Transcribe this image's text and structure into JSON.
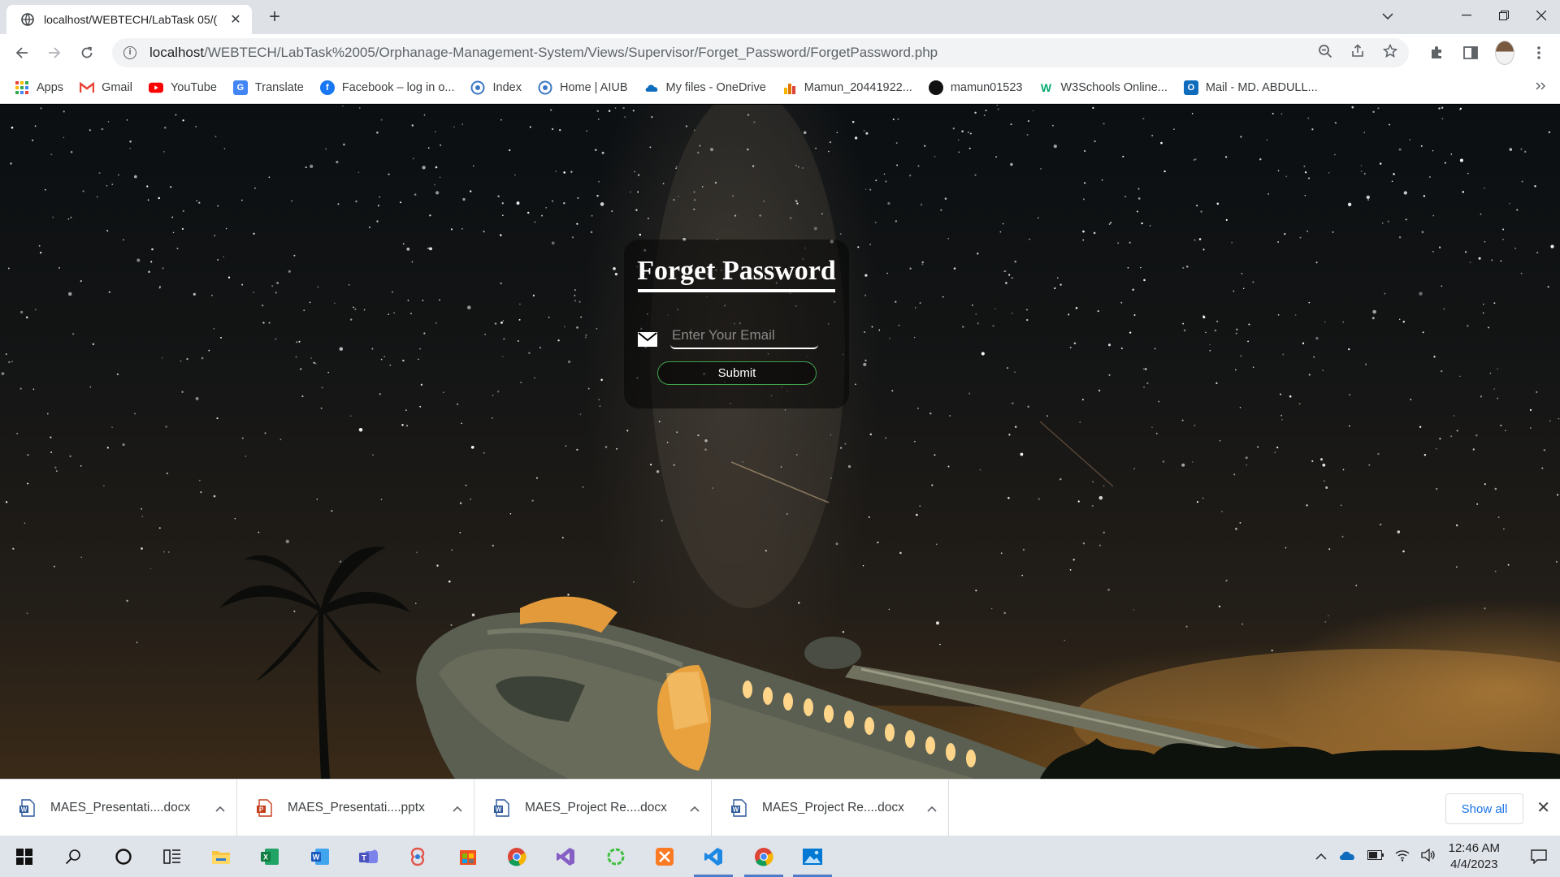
{
  "browser": {
    "tab_title": "localhost/WEBTECH/LabTask 05/(",
    "new_tab_symbol": "+",
    "url_host": "localhost",
    "url_path": "/WEBTECH/LabTask%2005/Orphanage-Management-System/Views/Supervisor/Forget_Password/ForgetPassword.php"
  },
  "bookmarks": [
    {
      "label": "Apps",
      "icon": "apps-grid-icon",
      "color": "#ea4335"
    },
    {
      "label": "Gmail",
      "icon": "gmail-icon",
      "color": "#ea4335"
    },
    {
      "label": "YouTube",
      "icon": "youtube-icon",
      "color": "#ff0000"
    },
    {
      "label": "Translate",
      "icon": "translate-icon",
      "color": "#4285f4"
    },
    {
      "label": "Facebook – log in o...",
      "icon": "facebook-icon",
      "color": "#1877f2"
    },
    {
      "label": "Index",
      "icon": "globe-icon",
      "color": "#3c78c4"
    },
    {
      "label": "Home | AIUB",
      "icon": "globe-icon",
      "color": "#3c78c4"
    },
    {
      "label": "My files - OneDrive",
      "icon": "onedrive-icon",
      "color": "#0f6cbd"
    },
    {
      "label": "Mamun_20441922...",
      "icon": "chart-icon",
      "color": "#e37400"
    },
    {
      "label": "mamun01523",
      "icon": "github-icon",
      "color": "#111111"
    },
    {
      "label": "W3Schools Online...",
      "icon": "w3schools-icon",
      "color": "#04aa6d"
    },
    {
      "label": "Mail - MD. ABDULL...",
      "icon": "outlook-icon",
      "color": "#0f6cbd"
    }
  ],
  "form": {
    "title": "Forget Password",
    "email_placeholder": "Enter Your Email",
    "email_value": "",
    "submit_label": "Submit",
    "submit_border_color": "#3ea04a"
  },
  "downloads": {
    "items": [
      {
        "name": "MAES_Presentati....docx",
        "type": "word"
      },
      {
        "name": "MAES_Presentati....pptx",
        "type": "powerpoint"
      },
      {
        "name": "MAES_Project Re....docx",
        "type": "word"
      },
      {
        "name": "MAES_Project Re....docx",
        "type": "word"
      }
    ],
    "show_all_label": "Show all"
  },
  "taskbar": {
    "time": "12:46 AM",
    "date": "4/4/2023",
    "apps": [
      "windows-start",
      "search",
      "cortana",
      "task-view",
      "file-explorer",
      "excel",
      "word",
      "teams",
      "paint-3d",
      "microsoft-store",
      "chrome",
      "visual-studio",
      "circular-app",
      "xampp",
      "vscode",
      "chrome-active",
      "photos"
    ]
  }
}
